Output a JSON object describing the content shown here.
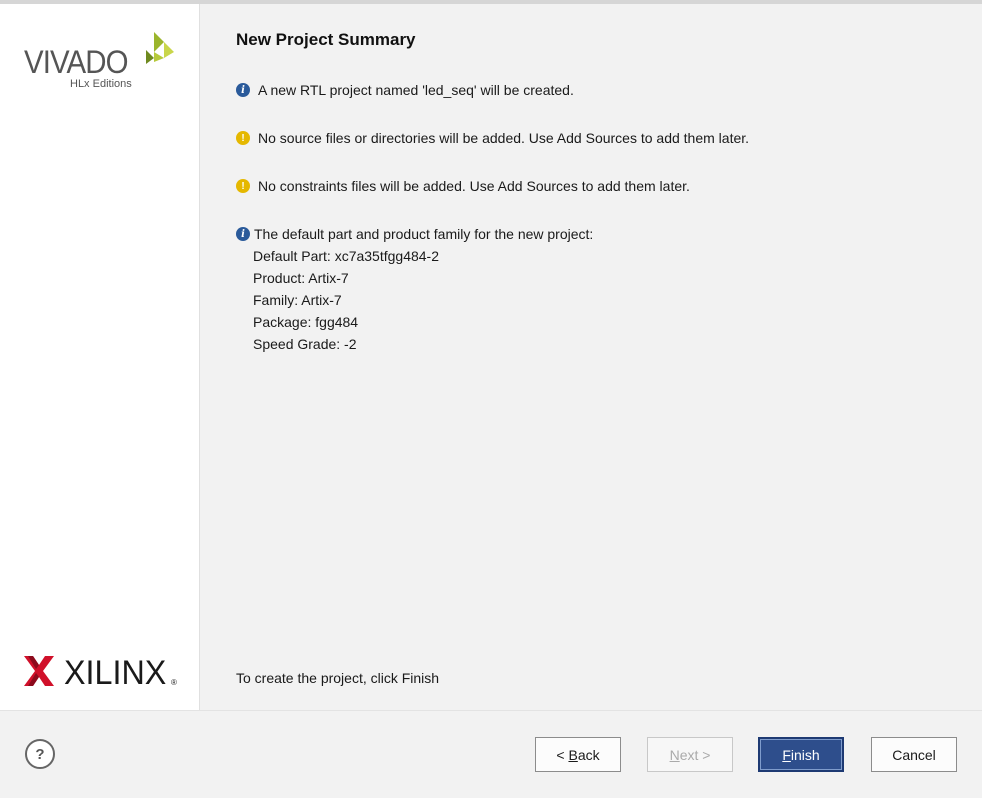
{
  "sidebar": {
    "vivado_logo": {
      "word": "VIVADO",
      "sub": "HLx Editions"
    },
    "xilinx_logo": {
      "word": "XILINX",
      "reg": "®"
    }
  },
  "page": {
    "title": "New Project Summary",
    "messages": [
      {
        "type": "info",
        "icon": "info-icon",
        "text": "A new RTL project named 'led_seq' will be created."
      },
      {
        "type": "warning",
        "icon": "warning-icon",
        "text": "No source files or directories will be added. Use Add Sources to add them later."
      },
      {
        "type": "warning",
        "icon": "warning-icon",
        "text": "No constraints files will be added. Use Add Sources to add them later."
      },
      {
        "type": "info",
        "icon": "info-icon",
        "text": "The default part and product family for the new project:"
      }
    ],
    "details": [
      "Default Part: xc7a35tfgg484-2",
      "Product: Artix-7",
      "Family: Artix-7",
      "Package: fgg484",
      "Speed Grade: -2"
    ],
    "hint": "To create the project, click Finish"
  },
  "buttons": {
    "help": "?",
    "back_prefix": "< ",
    "back_mnemonic": "B",
    "back_rest": "ack",
    "next_mnemonic": "N",
    "next_rest": "ext >",
    "finish_mnemonic": "F",
    "finish_rest": "inish",
    "cancel": "Cancel"
  },
  "colors": {
    "primary": "#2e4e8c",
    "info": "#2a5a9a",
    "warning": "#e5b800",
    "vivado_green": "#8aa626"
  }
}
